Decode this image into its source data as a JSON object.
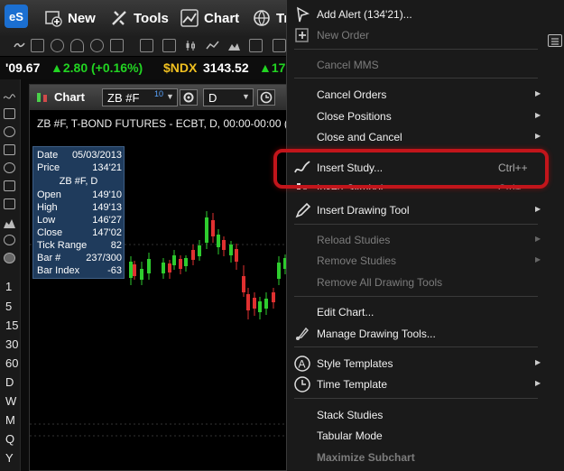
{
  "toolbar": {
    "logo": "eS",
    "new_label": "New",
    "tools_label": "Tools",
    "chart_label": "Chart",
    "trade_label_partial": "Tr"
  },
  "ticker": {
    "prev_price": "'09.67",
    "prev_change": "▲2.80 (+0.16%)",
    "symbol": "$NDX",
    "price": "3143.52",
    "change_partial": "▲17",
    "up_color": "#22d422",
    "symbol_color": "#f0c020"
  },
  "sidebar": {
    "intervals": [
      "1",
      "5",
      "15",
      "30",
      "60",
      "D",
      "W",
      "M",
      "Q",
      "Y"
    ]
  },
  "chart": {
    "window_title": "Chart",
    "symbol": "ZB #F",
    "symbol_superscript": "10",
    "interval": "D",
    "description": "ZB #F, T-BOND FUTURES - ECBT, D, 00:00-00:00 (Dyn"
  },
  "data_window": {
    "date_label": "Date",
    "date_value": "05/03/2013",
    "price_label": "Price",
    "price_value": "134'21",
    "title": "ZB #F, D",
    "open_label": "Open",
    "open_value": "149'10",
    "high_label": "High",
    "high_value": "149'13",
    "low_label": "Low",
    "low_value": "146'27",
    "close_label": "Close",
    "close_value": "147'02",
    "range_label": "Tick Range",
    "range_value": "82",
    "bar_label": "Bar #",
    "bar_value": "237/300",
    "index_label": "Bar Index",
    "index_value": "-63"
  },
  "menu": {
    "add_alert": "Add Alert (134'21)...",
    "new_order": "New Order",
    "cancel_mms": "Cancel MMS",
    "cancel_orders": "Cancel Orders",
    "close_positions": "Close Positions",
    "close_and_cancel": "Close and Cancel",
    "insert_study": "Insert Study...",
    "insert_study_shortcut": "Ctrl++",
    "insert_symbol": "Insert Symbol...",
    "insert_symbol_shortcut": "Ctrl+",
    "insert_drawing_tool": "Insert Drawing Tool",
    "reload_studies": "Reload Studies",
    "remove_studies": "Remove Studies",
    "remove_all_drawing_tools": "Remove All Drawing Tools",
    "edit_chart": "Edit Chart...",
    "manage_drawing_tools": "Manage Drawing Tools...",
    "style_templates": "Style Templates",
    "time_template": "Time Template",
    "stack_studies": "Stack Studies",
    "tabular_mode": "Tabular Mode",
    "maximize_subchart": "Maximize Subchart",
    "highlight_color": "#c2151b"
  }
}
